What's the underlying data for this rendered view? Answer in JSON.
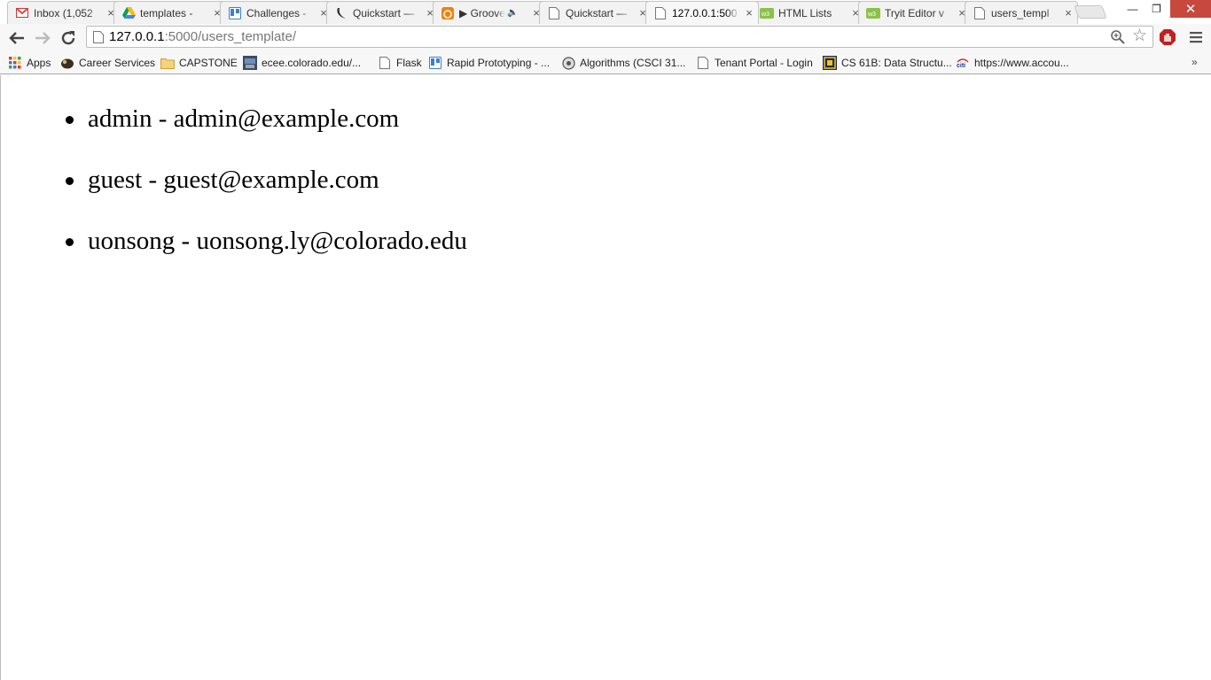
{
  "window": {
    "minimize_label": "—",
    "restore_label": "❐",
    "close_label": "✕"
  },
  "tabs": [
    {
      "title": "Inbox (1,052",
      "icon": "gmail-icon",
      "active": false
    },
    {
      "title": "templates - ",
      "icon": "google-drive-icon",
      "active": false
    },
    {
      "title": "Challenges -",
      "icon": "trello-icon",
      "active": false
    },
    {
      "title": "Quickstart —",
      "icon": "flask-icon",
      "active": false
    },
    {
      "title": "▶ Groove",
      "icon": "grooveshark-icon",
      "active": false,
      "audio": true
    },
    {
      "title": "Quickstart —",
      "icon": "page-icon",
      "active": false
    },
    {
      "title": "127.0.0.1:500",
      "icon": "page-icon",
      "active": true
    },
    {
      "title": "HTML Lists",
      "icon": "w3schools-icon",
      "active": false
    },
    {
      "title": "Tryit Editor v",
      "icon": "w3schools-icon",
      "active": false
    },
    {
      "title": "users_templ",
      "icon": "page-icon",
      "active": false
    }
  ],
  "address_bar": {
    "host": "127.0.0.1",
    "rest": ":5000/users_template/"
  },
  "bookmarks": [
    {
      "label": "Apps",
      "icon": "apps-grid-icon"
    },
    {
      "label": "Career Services",
      "icon": "cu-buffalo-icon"
    },
    {
      "label": "CAPSTONE",
      "icon": "folder-icon"
    },
    {
      "label": "ecee.colorado.edu/...",
      "icon": "site-thumbnail-icon"
    },
    {
      "label": "Flask",
      "icon": "page-icon"
    },
    {
      "label": "Rapid Prototyping - ...",
      "icon": "trello-icon"
    },
    {
      "label": "Algorithms (CSCI 31...",
      "icon": "gear-icon"
    },
    {
      "label": "Tenant Portal - Login",
      "icon": "page-icon"
    },
    {
      "label": "CS 61B: Data Structu...",
      "icon": "cs61b-icon"
    },
    {
      "label": "https://www.accou...",
      "icon": "citi-icon"
    }
  ],
  "bookmarks_more": "»",
  "page": {
    "users": [
      {
        "text": "admin - admin@example.com"
      },
      {
        "text": "guest - guest@example.com"
      },
      {
        "text": "uonsong - uonsong.ly@colorado.edu"
      }
    ]
  },
  "colors": {
    "close_button": "#c7483e",
    "url_host": "#000000",
    "url_rest": "#777777"
  }
}
